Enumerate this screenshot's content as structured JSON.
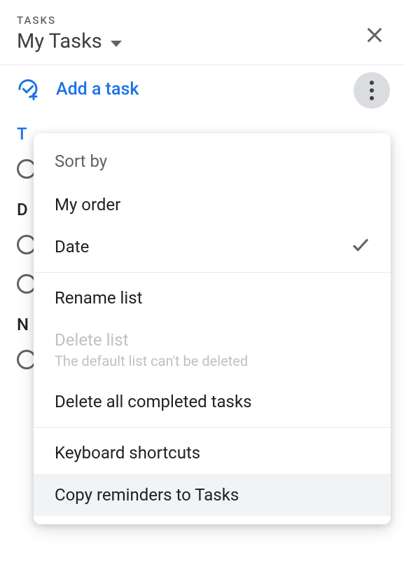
{
  "header": {
    "appLabel": "TASKS",
    "listName": "My Tasks"
  },
  "addTask": {
    "label": "Add a task"
  },
  "sections": {
    "today": "T",
    "d": "D",
    "n": "N"
  },
  "menu": {
    "sortBy": "Sort by",
    "myOrder": "My order",
    "date": "Date",
    "renameList": "Rename list",
    "deleteList": "Delete list",
    "deleteListSub": "The default list can't be deleted",
    "deleteCompleted": "Delete all completed tasks",
    "keyboardShortcuts": "Keyboard shortcuts",
    "copyReminders": "Copy reminders to Tasks"
  }
}
